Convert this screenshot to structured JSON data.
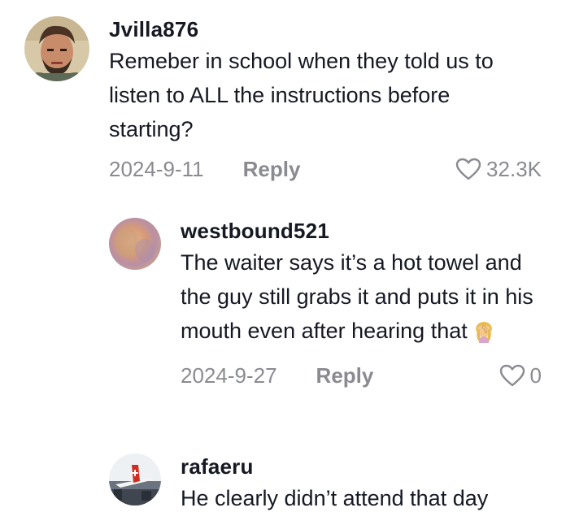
{
  "comments": [
    {
      "username": "Jvilla876",
      "text": "Remeber in school when they told us to listen to ALL the instructions before starting?",
      "date": "2024-9-11",
      "reply_label": "Reply",
      "likes": "32.3K",
      "avatar_icon": "user-avatar-man-beard"
    },
    {
      "username": "westbound521",
      "text": "The waiter says it’s a hot towel and the guy still grabs it and puts it in his mouth even after hearing that",
      "emoji": "woman-facepalming-emoji",
      "date": "2024-9-27",
      "reply_label": "Reply",
      "likes": "0",
      "avatar_icon": "user-avatar-blurred"
    },
    {
      "username": "rafaeru",
      "text": "He clearly didn’t attend that day",
      "avatar_icon": "user-avatar-airplane"
    }
  ],
  "colors": {
    "text": "#161823",
    "secondary": "#8a8b91",
    "background": "#ffffff"
  }
}
